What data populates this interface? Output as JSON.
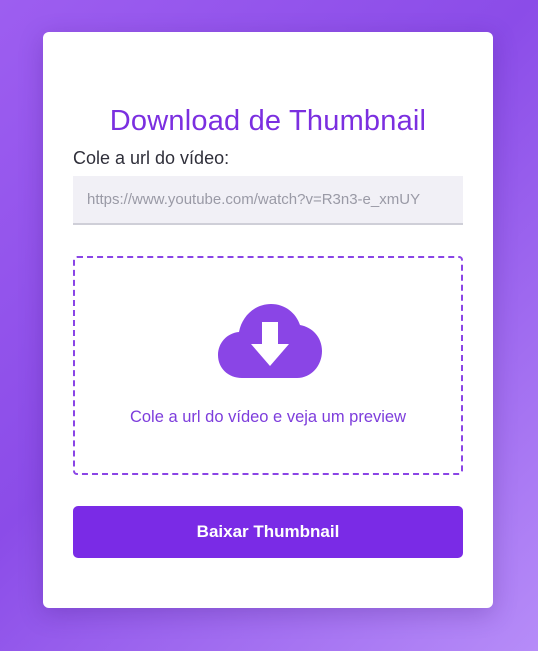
{
  "card": {
    "title": "Download de Thumbnail",
    "url_label": "Cole a url do vídeo:",
    "url_input": {
      "value": "",
      "placeholder": "https://www.youtube.com/watch?v=R3n3-e_xmUY"
    },
    "preview": {
      "icon": "cloud-download-icon",
      "text": "Cole a url do vídeo e veja um preview"
    },
    "button_label": "Baixar Thumbnail"
  },
  "colors": {
    "accent": "#7a2be6",
    "title": "#7b2fe0",
    "background_gradient": [
      "#9d5ef0",
      "#8b4ce8",
      "#b68cf8"
    ],
    "input_background": "#f1f0f6",
    "dashed_border": "#8a45e6"
  }
}
